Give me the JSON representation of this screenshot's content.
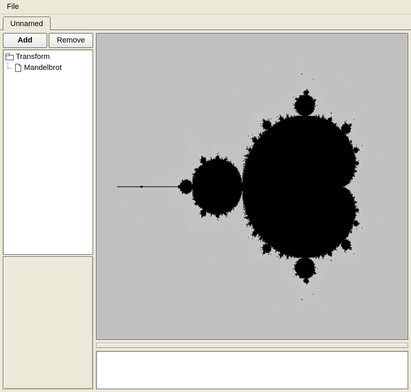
{
  "menubar": {
    "file": "File"
  },
  "tabs": {
    "active": "Unnamed"
  },
  "sidebar": {
    "add_label": "Add",
    "remove_label": "Remove",
    "tree": {
      "root": "Transform",
      "items": [
        {
          "label": "Mandelbrot"
        }
      ]
    }
  },
  "viewport": {
    "content_type": "fractal",
    "description": "Mandelbrot"
  }
}
